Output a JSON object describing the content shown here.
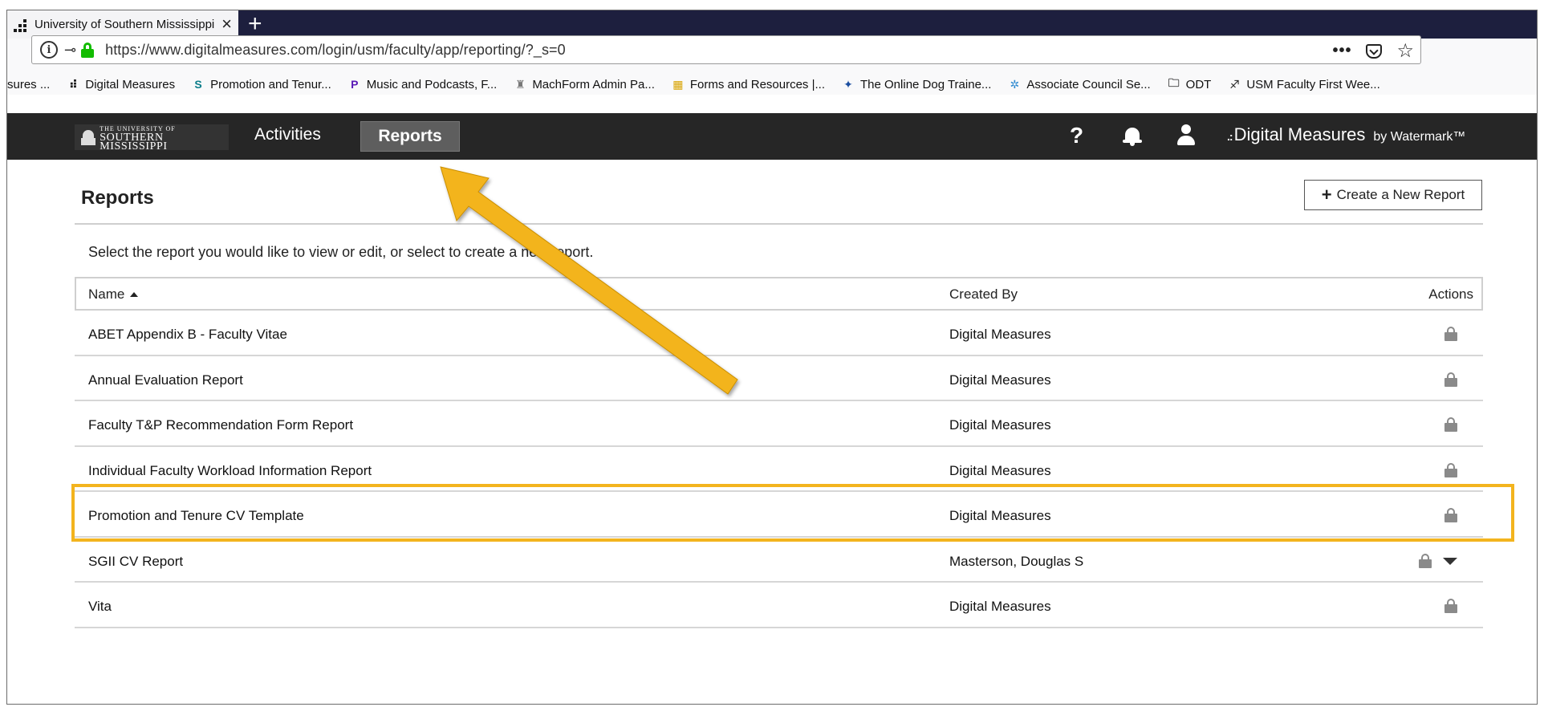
{
  "browser": {
    "tab_title": "University of Southern Mississippi",
    "url": "https://www.digitalmeasures.com/login/usm/faculty/app/reporting/?_s=0",
    "bookmarks": [
      {
        "label": "sures ...",
        "icon": ""
      },
      {
        "label": "Digital Measures",
        "icon": "digital-measures-icon"
      },
      {
        "label": "Promotion and Tenur...",
        "icon": "sharepoint-icon"
      },
      {
        "label": "Music and Podcasts, F...",
        "icon": "pandora-icon"
      },
      {
        "label": "MachForm Admin Pa...",
        "icon": "machform-icon"
      },
      {
        "label": "Forms and Resources |...",
        "icon": "forms-icon"
      },
      {
        "label": "The Online Dog Traine...",
        "icon": "dog-trainer-icon"
      },
      {
        "label": "Associate Council Se...",
        "icon": "council-icon"
      },
      {
        "label": "ODT",
        "icon": "folder-icon"
      },
      {
        "label": "USM Faculty First Wee...",
        "icon": "usm-icon"
      }
    ]
  },
  "app": {
    "logo_small": "THE UNIVERSITY OF",
    "logo_big": "SOUTHERN MISSISSIPPI",
    "nav_activities": "Activities",
    "nav_reports": "Reports",
    "help_label": "?",
    "brand_dots": ".:",
    "brand_name": "Digital Measures",
    "brand_by": "by Watermark™"
  },
  "page": {
    "title": "Reports",
    "create_button": "Create a New Report",
    "intro": "Select the report you would like to view or edit, or select to create a new report.",
    "columns": {
      "name": "Name",
      "created_by": "Created By",
      "actions": "Actions"
    },
    "rows": [
      {
        "name": "ABET Appendix B - Faculty Vitae",
        "created_by": "Digital Measures"
      },
      {
        "name": "Annual Evaluation Report",
        "created_by": "Digital Measures"
      },
      {
        "name": "Faculty T&P Recommendation Form Report",
        "created_by": "Digital Measures"
      },
      {
        "name": "Individual Faculty Workload Information Report",
        "created_by": "Digital Measures"
      },
      {
        "name": "Promotion and Tenure CV Template",
        "created_by": "Digital Measures"
      },
      {
        "name": "SGII CV Report",
        "created_by": "Masterson, Douglas S"
      },
      {
        "name": "Vita",
        "created_by": "Digital Measures"
      }
    ]
  },
  "colors": {
    "highlight": "#f3b41e",
    "appbar": "#262626",
    "tabstrip": "#1d1f3e"
  }
}
